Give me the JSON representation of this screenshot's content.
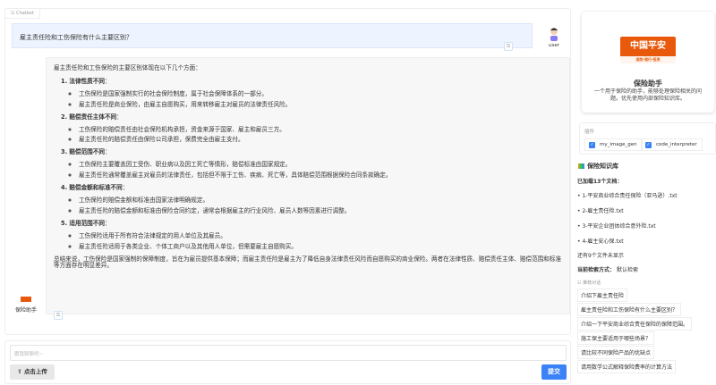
{
  "chatbot": {
    "label": "Chatbot",
    "user_message": "雇主责任险和工伤保险有什么主要区别？",
    "user_name": "user",
    "bot_name": "保险助手",
    "bot_intro": "雇主责任险和工伤保险的主要区别体现在以下几个方面：",
    "sections": [
      {
        "title": "1. 法律性质不同",
        "items": [
          "工伤保险是国家强制实行的社会保险制度，属于社会保障体系的一部分。",
          "雇主责任险是商业保险，由雇主自愿购买，用来转移雇主对雇员的法律责任风险。"
        ]
      },
      {
        "title": "2. 赔偿责任主体不同",
        "items": [
          "工伤保险的赔偿责任由社会保险机构承担，资金来源于国家、雇主和雇员三方。",
          "雇主责任险的赔偿责任由保险公司承担，保费完全由雇主支付。"
        ]
      },
      {
        "title": "3. 赔偿范围不同",
        "items": [
          "工伤保险主要覆盖因工受伤、职业病以及因工死亡等情形，赔偿标准由国家规定。",
          "雇主责任险通常覆盖雇主对雇员的法律责任，包括但不限于工伤、疾病、死亡等，具体赔偿范围根据保险合同条款确定。"
        ]
      },
      {
        "title": "4. 赔偿金额和标准不同",
        "items": [
          "工伤保险的赔偿金额和标准由国家法律明确规定。",
          "雇主责任险的赔偿金额和标准由保险合同约定，通常会根据雇主的行业风险、雇员人数等因素进行调整。"
        ]
      },
      {
        "title": "5. 适用范围不同",
        "items": [
          "工伤保险适用于所有符合法律规定的用人单位及其雇员。",
          "雇主责任险适用于各类企业、个体工商户以及其他用人单位，但需要雇主自愿购买。"
        ]
      }
    ],
    "bot_summary": "总结来说，工伤保险是国家强制的保障制度，旨在为雇员提供基本保障；而雇主责任险是雇主为了降低自身法律责任风险而自愿购买的商业保险。两者在法律性质、赔偿责任主体、赔偿范围和标准等方面存在明显差异。"
  },
  "input": {
    "placeholder": "跟我聊聊吧~",
    "upload_label": "点击上传",
    "submit_label": "提交"
  },
  "assistant_card": {
    "logo_text": "中国平安",
    "logo_sub": "保险·银行·投资",
    "title": "保险助手",
    "description": "一个用于保险的助手，能够处理保险相关的问题。优先使用内部保险知识库。"
  },
  "plugins": {
    "label": "插件",
    "items": [
      {
        "name": "my_image_gen",
        "checked": true
      },
      {
        "name": "code_interpreter",
        "checked": true
      }
    ]
  },
  "knowledge": {
    "title": "保险知识库",
    "loaded": "已加载13个文档：",
    "docs": [
      "1-平安商业综合责任保险（亚马逊）.txt",
      "2-雇主责任险.txt",
      "3-平安企业团体综合意外险.txt",
      "4-雇主安心保.txt"
    ],
    "more": "还有9个文件未显示",
    "retrieval_label": "当前检索方式：",
    "retrieval_value": "默认检索"
  },
  "suggestions": {
    "label": "推荐对话",
    "items": [
      "介绍下雇主责任险",
      "雇主责任险和工伤保险有什么主要区别？",
      "介绍一下平安商业综合责任保险的保障范围。",
      "施工保主要适用于哪些场景？",
      "请比较不同保险产品的优缺点",
      "请用数学公式解释保险费率的计算方法"
    ]
  }
}
